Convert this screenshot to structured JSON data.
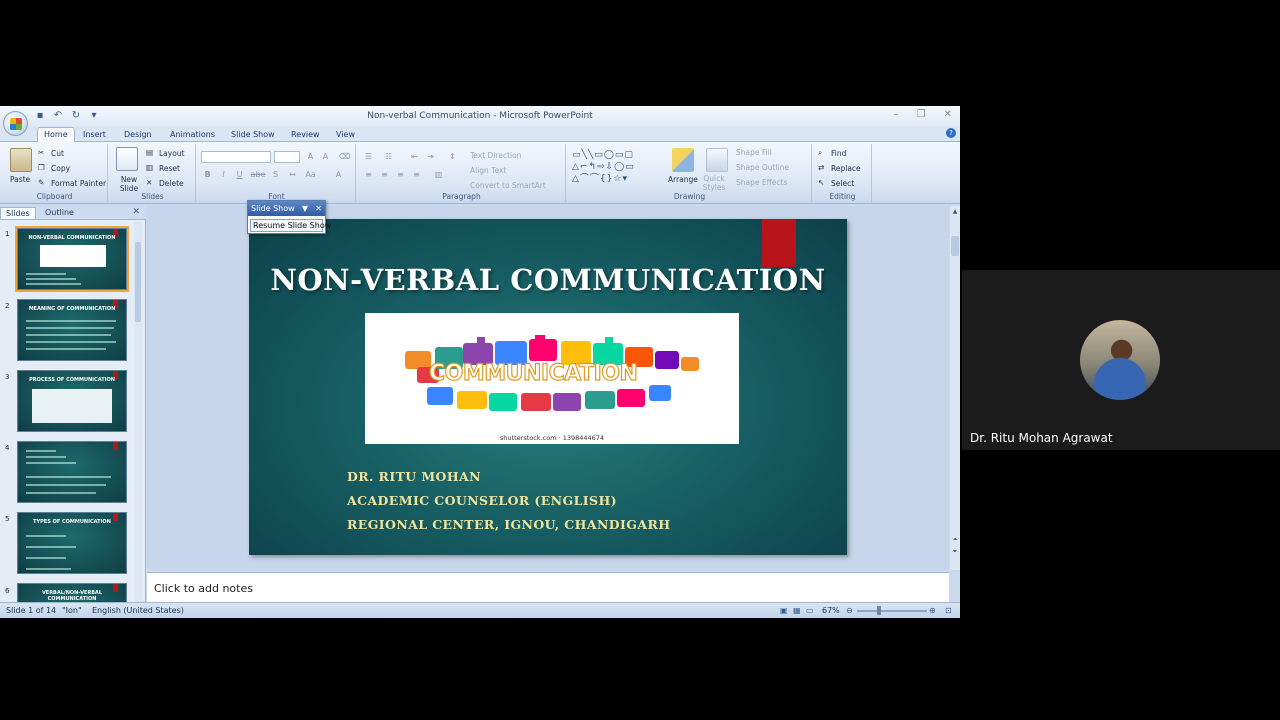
{
  "window": {
    "title": "Non-verbal Communication - Microsoft PowerPoint",
    "controls": [
      "–",
      "❐",
      "✕"
    ]
  },
  "ribbon_tabs": [
    "Home",
    "Insert",
    "Design",
    "Animations",
    "Slide Show",
    "Review",
    "View"
  ],
  "active_tab": "Home",
  "ribbon": {
    "clipboard": {
      "paste": "Paste",
      "cut": "Cut",
      "copy": "Copy",
      "format_painter": "Format Painter",
      "label": "Clipboard"
    },
    "slides": {
      "new_slide": "New Slide",
      "layout": "Layout",
      "reset": "Reset",
      "delete": "Delete",
      "label": "Slides"
    },
    "font": {
      "label": "Font",
      "bold": "B",
      "italic": "I",
      "underline": "U",
      "strike": "abe",
      "shadow": "S"
    },
    "paragraph": {
      "text_direction": "Text Direction",
      "align_text": "Align Text",
      "convert_smartart": "Convert to SmartArt",
      "label": "Paragraph"
    },
    "drawing": {
      "arrange": "Arrange",
      "quick_styles": "Quick Styles",
      "shape_fill": "Shape Fill",
      "shape_outline": "Shape Outline",
      "shape_effects": "Shape Effects",
      "label": "Drawing"
    },
    "editing": {
      "find": "Find",
      "replace": "Replace",
      "select": "Select",
      "label": "Editing"
    }
  },
  "pane": {
    "tabs": [
      "Slides",
      "Outline"
    ],
    "active": "Slides",
    "thumbnails": [
      {
        "num": "1",
        "title": "NON-VERBAL COMMUNICATION"
      },
      {
        "num": "2",
        "title": "MEANING OF COMMUNICATION"
      },
      {
        "num": "3",
        "title": "PROCESS OF COMMUNICATION"
      },
      {
        "num": "4",
        "title": ""
      },
      {
        "num": "5",
        "title": "TYPES OF COMMUNICATION"
      },
      {
        "num": "6",
        "title": "VERBAL/NON-VERBAL COMMUNICATION"
      }
    ]
  },
  "slide": {
    "title": "NON-VERBAL COMMUNICATION",
    "image_word": "COMMUNICATION",
    "image_credit": "shutterstock.com · 1398444674",
    "lines": [
      "DR. RITU MOHAN",
      "ACADEMIC COUNSELOR (ENGLISH)",
      "REGIONAL CENTER, IGNOU, CHANDIGARH"
    ]
  },
  "slideshow_toolbar": {
    "title": "Slide Show",
    "button": "Resume Slide Show"
  },
  "notes_placeholder": "Click to add notes",
  "status": {
    "slide_info": "Slide 1 of 14",
    "theme": "\"Ion\"",
    "language": "English (United States)",
    "zoom": "67%"
  },
  "participant": {
    "name": "Dr. Ritu Mohan Agrawat"
  },
  "colors": {
    "ribbon": "#dce7f5",
    "slide_bg": "#176065",
    "slide_accent_red": "#b8151b",
    "slide_text_gold": "#f1e39a"
  }
}
